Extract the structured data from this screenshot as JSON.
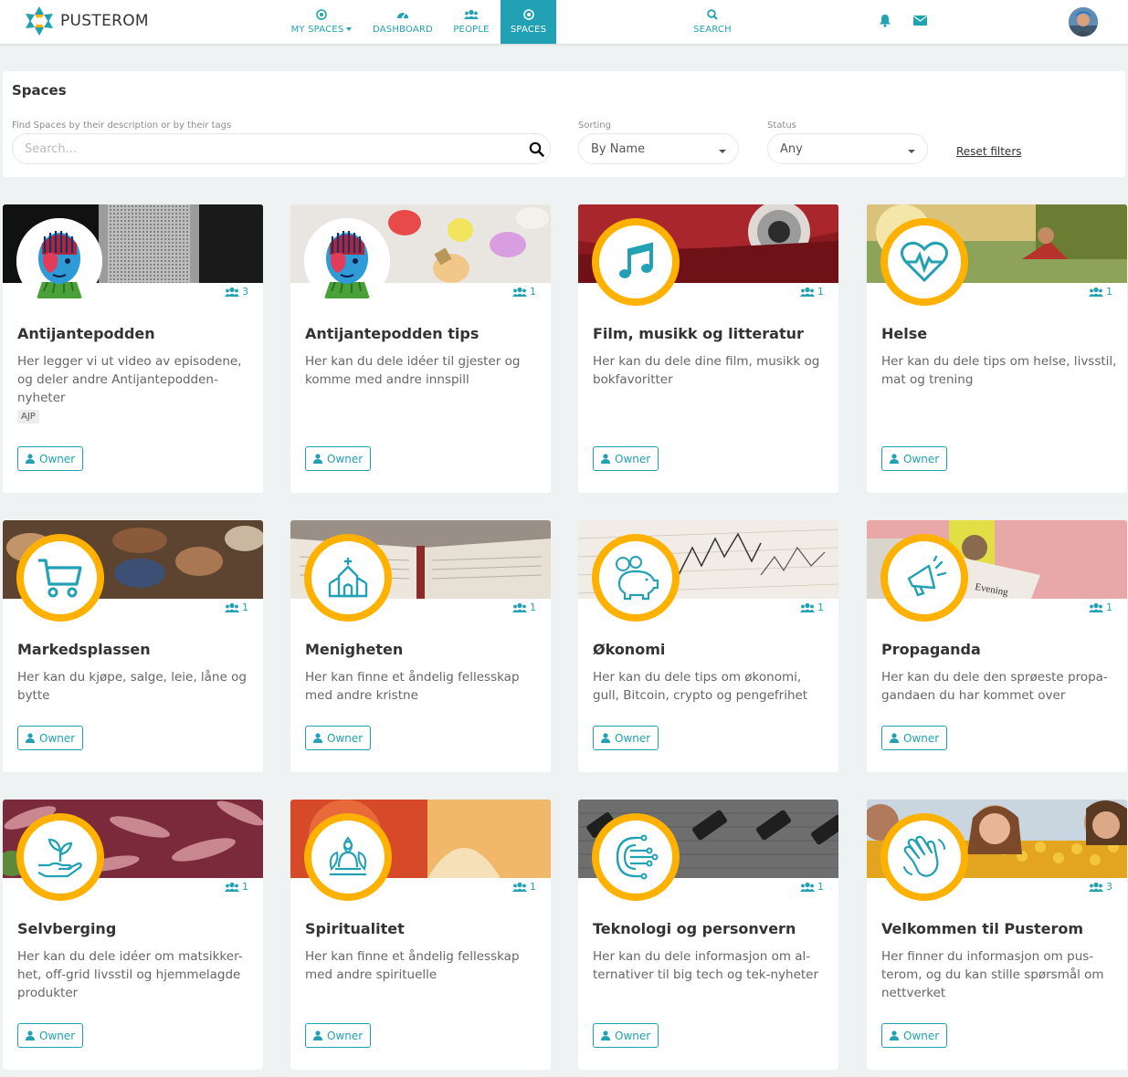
{
  "app": {
    "brand": "PUSTEROM"
  },
  "nav": [
    {
      "label": "MY SPACES",
      "icon": "target-icon"
    },
    {
      "label": "DASHBOARD",
      "icon": "dashboard-icon"
    },
    {
      "label": "PEOPLE",
      "icon": "people-icon"
    },
    {
      "label": "SPACES",
      "icon": "target-icon",
      "active": true
    },
    {
      "label": "SEARCH",
      "icon": "search-icon"
    }
  ],
  "filters": {
    "title": "Spaces",
    "search_label": "Find Spaces by their description or by their tags",
    "search_placeholder": "Search...",
    "sorting_label": "Sorting",
    "sorting_value": "By Name",
    "status_label": "Status",
    "status_value": "Any",
    "reset_label": "Reset filters"
  },
  "owner_label": "Owner",
  "spaces": [
    {
      "title": "Antijantepodden",
      "desc": "Her legger vi ut video av episodene, og deler andre Antijantepodden-nyheter",
      "members": "3",
      "tag": "AJP",
      "icon": "face-logo-icon"
    },
    {
      "title": "Antijantepodden tips",
      "desc": "Her kan du dele idéer til gjester og komme med andre innspill",
      "members": "1",
      "icon": "face-logo-icon"
    },
    {
      "title": "Film, musikk og litteratur",
      "desc": "Her kan du dele dine film, musikk og bokfavoritter",
      "members": "1",
      "icon": "music-note-icon"
    },
    {
      "title": "Helse",
      "desc": "Her kan du dele tips om helse, livsstil, mat og trening",
      "members": "1",
      "icon": "heartbeat-icon"
    },
    {
      "title": "Markedsplassen",
      "desc": "Her kan du kjøpe, salge, leie, låne og bytte",
      "members": "1",
      "icon": "shopping-cart-icon"
    },
    {
      "title": "Menigheten",
      "desc": "Her kan finne et åndelig fellesskap med andre kristne",
      "members": "1",
      "icon": "church-icon"
    },
    {
      "title": "Økonomi",
      "desc": "Her kan du dele tips om økonomi, gull, Bitcoin, crypto og pengefrihet",
      "members": "1",
      "icon": "piggy-bank-icon"
    },
    {
      "title": "Propaganda",
      "desc": "Her kan du dele den sprøeste propa-gandaen du har kommet over",
      "members": "1",
      "icon": "megaphone-icon"
    },
    {
      "title": "Selvberging",
      "desc": "Her kan du dele idéer om matsikker-het, off-grid livsstil og hjemmelagde produkter",
      "members": "1",
      "icon": "plant-hand-icon"
    },
    {
      "title": "Spiritualitet",
      "desc": "Her kan finne et åndelig fellesskap med andre spirituelle",
      "members": "1",
      "icon": "meditation-icon"
    },
    {
      "title": "Teknologi og personvern",
      "desc": "Her kan du dele informasjon om al-ternativer til big tech og tek-nyheter",
      "members": "1",
      "icon": "circuit-icon"
    },
    {
      "title": "Velkommen til Pusterom",
      "desc": "Her finner du informasjon om pus-terom, og du kan stille spørsmål om nettverket",
      "members": "3",
      "icon": "waving-hand-icon"
    }
  ],
  "colors": {
    "accent": "#21a1b3",
    "badge_ring": "#ffb100"
  }
}
